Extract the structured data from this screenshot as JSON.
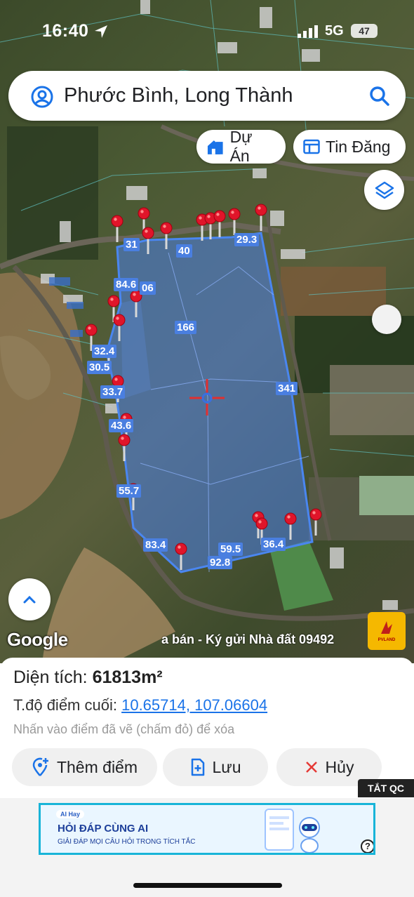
{
  "status_bar": {
    "time": "16:40",
    "network": "5G",
    "battery": "47"
  },
  "search": {
    "text": "Phước Bình, Long Thành"
  },
  "chips": {
    "du_an": "Dự Án",
    "tin_dang": "Tin Đăng"
  },
  "map": {
    "google_label": "Google",
    "ticker_text": "a bán - Ký gửi Nhà đất 09492",
    "measure_labels": [
      "31",
      "40",
      "29.3",
      "84.6",
      "06",
      "166",
      "32.4",
      "30.5",
      "33.7",
      "341",
      "43.6",
      "55.7",
      "83.4",
      "59.5",
      "92.8",
      "36.4"
    ],
    "polygon_color": "#4a86f0"
  },
  "sheet": {
    "area_label": "Diện tích:",
    "area_value": "61813m²",
    "coord_label": "T.độ điểm cuối:",
    "coord_value": "10.65714, 107.06604",
    "hint": "Nhấn vào điểm đã vẽ (chấm đỏ) để xóa",
    "add_point": "Thêm điểm",
    "save": "Lưu",
    "cancel": "Hủy",
    "ad_close": "TẮT QC"
  },
  "ad": {
    "brand": "AI Hay",
    "title": "HỎI ĐÁP CÙNG AI",
    "subtitle": "GIẢI ĐÁP MỌI CÂU HỎI TRONG TÍCH TẮC",
    "help": "?"
  }
}
